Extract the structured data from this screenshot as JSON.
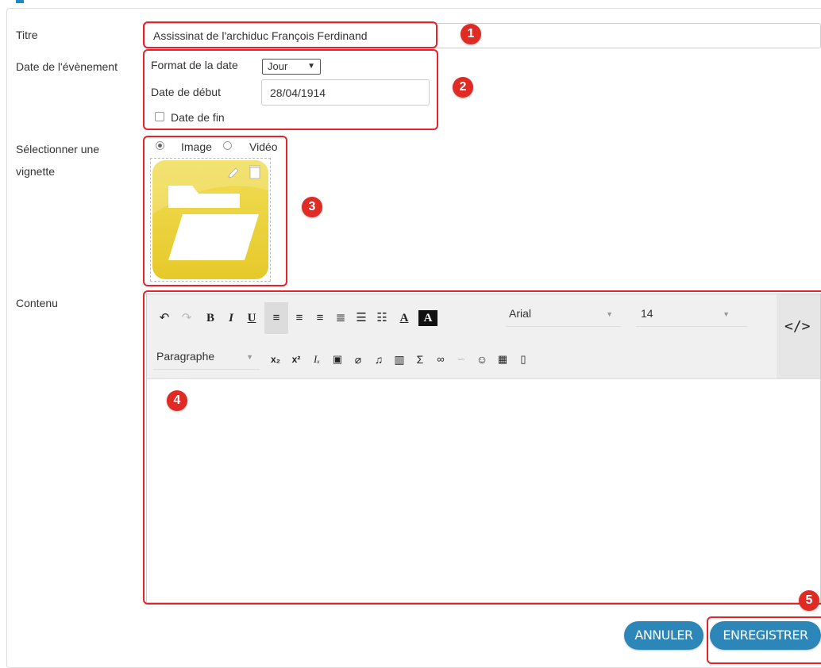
{
  "form": {
    "title_label": "Titre",
    "title_value": "Assissinat de l'archiduc François Ferdinand",
    "date_label": "Date de l'évènement",
    "date_format_label": "Format de la date",
    "date_format_value": "Jour",
    "start_date_label": "Date de début",
    "start_date_value": "28/04/1914",
    "end_date_label": "Date de fin",
    "thumb_label_line1": "Sélectionner une",
    "thumb_label_line2": "vignette",
    "radio_image": "Image",
    "radio_video": "Vidéo",
    "content_label": "Contenu"
  },
  "editor": {
    "font_value": "Arial",
    "size_value": "14",
    "block_value": "Paragraphe",
    "code_label": "</>"
  },
  "badges": [
    "1",
    "2",
    "3",
    "4",
    "5"
  ],
  "buttons": {
    "cancel": "ANNULER",
    "save": "ENREGISTRER"
  },
  "colors": {
    "annotation_red": "#e8222a",
    "button_blue": "#2d86b8",
    "folder_yellow": "#e9d233"
  }
}
